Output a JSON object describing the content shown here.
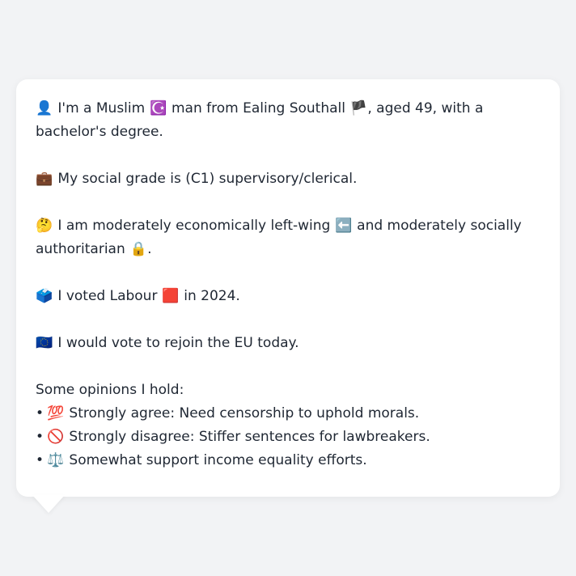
{
  "bio": {
    "identity": {
      "icon": "👤",
      "pre": "I'm a Muslim ",
      "religion_icon": "☪️",
      "mid": " man from Ealing Southall ",
      "flag_icon": "🏴",
      "post": ", aged 49, with a bachelor's degree."
    },
    "social_grade": {
      "icon": "💼",
      "text": "My social grade is (C1) supervisory/clerical."
    },
    "politics": {
      "icon": "🤔",
      "pre": "I am moderately economically left-wing ",
      "left_icon": "⬅️",
      "mid": " and moderately socially authoritarian ",
      "lock_icon": "🔒",
      "post": "."
    },
    "vote": {
      "icon": "🗳️",
      "pre": "I voted Labour ",
      "party_icon": "🟥",
      "post": " in 2024."
    },
    "eu": {
      "icon": "🇪🇺",
      "text": "I would vote to rejoin the EU today."
    }
  },
  "opinions": {
    "heading": "Some opinions I hold:",
    "bullet": "•",
    "items": [
      {
        "icon": "💯",
        "text": "Strongly agree: Need censorship to uphold morals."
      },
      {
        "icon": "🚫",
        "text": "Strongly disagree: Stiffer sentences for lawbreakers."
      },
      {
        "icon": "⚖️",
        "text": "Somewhat support income equality efforts."
      }
    ]
  }
}
